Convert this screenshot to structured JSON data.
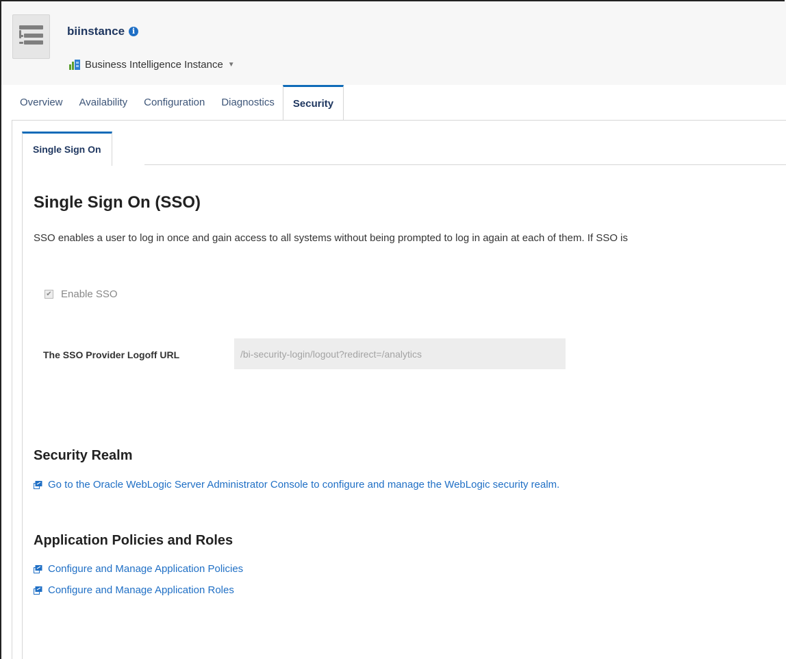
{
  "header": {
    "instance_name": "biinstance",
    "instance_type": "Business Intelligence Instance"
  },
  "tabs": [
    {
      "label": "Overview"
    },
    {
      "label": "Availability"
    },
    {
      "label": "Configuration"
    },
    {
      "label": "Diagnostics"
    },
    {
      "label": "Security",
      "active": true
    }
  ],
  "subtab": {
    "label": "Single Sign On"
  },
  "sso": {
    "heading": "Single Sign On (SSO)",
    "description": "SSO enables a user to log in once and gain access to all systems without being prompted to log in again at each of them. If SSO is",
    "enable_label": "Enable SSO",
    "enable_checked": true,
    "logoff_label": "The SSO Provider Logoff URL",
    "logoff_value": "/bi-security-login/logout?redirect=/analytics"
  },
  "security_realm": {
    "heading": "Security Realm",
    "link": "Go to the Oracle WebLogic Server Administrator Console to configure and manage the WebLogic security realm."
  },
  "app_policies": {
    "heading": "Application Policies and Roles",
    "links": [
      "Configure and Manage Application Policies",
      "Configure and Manage Application Roles"
    ]
  },
  "icons": {
    "app": "target-navigation-icon",
    "info": "info-icon",
    "instance_type": "bi-instance-icon",
    "dropdown": "caret-down-icon",
    "external_link": "external-link-icon"
  },
  "colors": {
    "accent": "#0f6bb8",
    "link": "#1f6fc5",
    "title": "#1f3760"
  }
}
